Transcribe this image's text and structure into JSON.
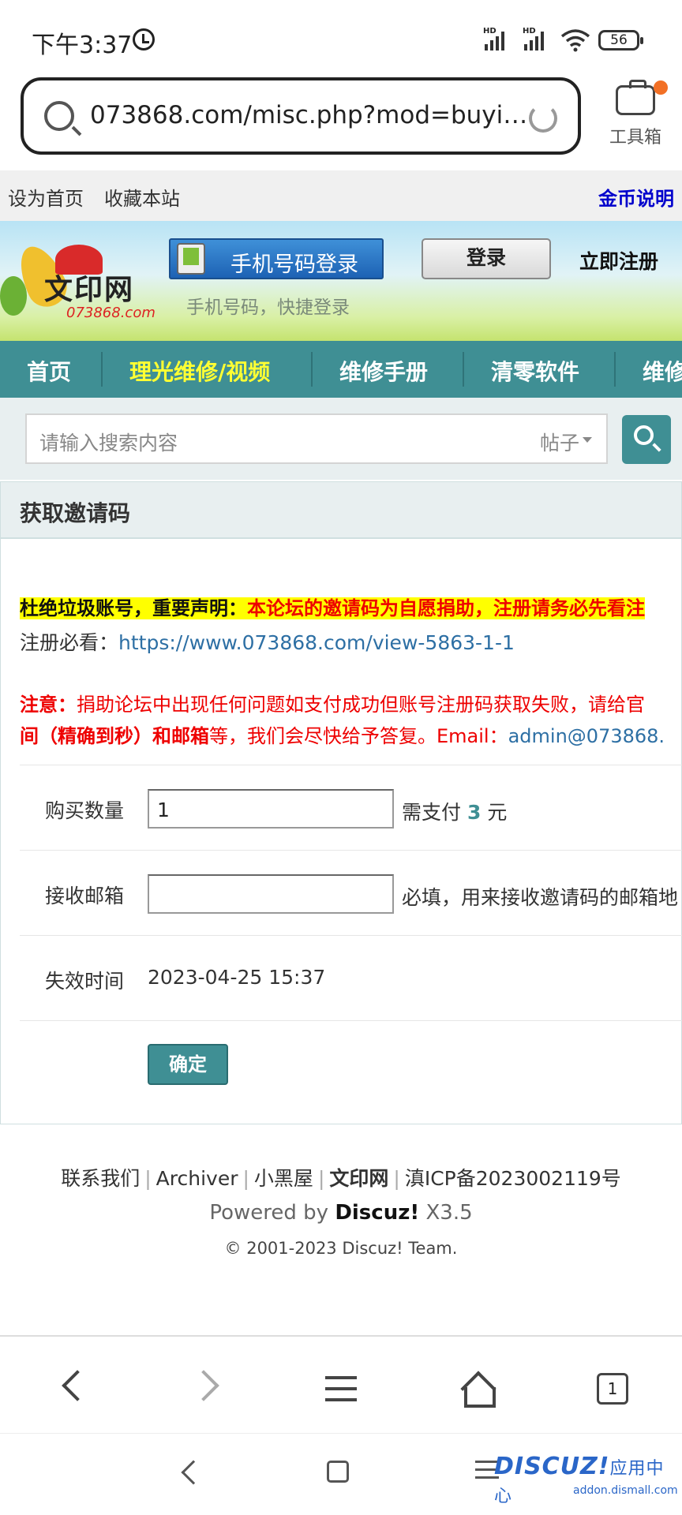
{
  "status_bar": {
    "time": "下午3:37",
    "battery": "56",
    "signal_label": "HD"
  },
  "browser": {
    "url": "073868.com/misc.php?mod=buyi…",
    "toolbox_label": "工具箱"
  },
  "top_links": {
    "set_home": "设为首页",
    "bookmark": "收藏本站",
    "coins": "金币说明"
  },
  "header": {
    "logo_text": "文印网",
    "logo_url": "073868.com",
    "phone_login": "手机号码登录",
    "phone_sub": "手机号码，快捷登录",
    "login": "登录",
    "register": "立即注册"
  },
  "nav": {
    "items": [
      {
        "label": "首页"
      },
      {
        "label": "理光维修/视频"
      },
      {
        "label": "维修手册"
      },
      {
        "label": "清零软件"
      },
      {
        "label": "维修"
      }
    ]
  },
  "search": {
    "placeholder": "请输入搜索内容",
    "type": "帖子"
  },
  "panel": {
    "title": "获取邀请码",
    "notice_bold": "杜绝垃圾账号，重要声明：",
    "notice_rest": "本论坛的邀请码为自愿捐助，注册请务必先看注",
    "must_label": "注册必看：",
    "must_link": "https://www.073868.com/view-5863-1-1",
    "warn_label": "注意：",
    "warn_line1": "捐助论坛中出现任何问题如支付成功但账号注册码获取失败，请给官",
    "warn_line2_bold": "间（精确到秒）和邮箱",
    "warn_line2_rest": "等，我们会尽快给予答复。Email：",
    "warn_email": "admin@073868.",
    "form": {
      "qty_label": "购买数量",
      "qty_value": "1",
      "pay_prefix": "需支付",
      "pay_amount": "3",
      "pay_unit": "元",
      "email_label": "接收邮箱",
      "email_value": "",
      "email_hint": "必填，用来接收邀请码的邮箱地",
      "expire_label": "失效时间",
      "expire_value": "2023-04-25 15:37",
      "submit": "确定"
    }
  },
  "footer": {
    "contact": "联系我们",
    "archiver": "Archiver",
    "blackroom": "小黑屋",
    "site": "文印网",
    "icp": "滇ICP备2023002119号",
    "powered_prefix": "Powered by",
    "powered_brand": "Discuz!",
    "powered_version": "X3.5",
    "copyright": "© 2001-2023 Discuz! Team."
  },
  "bottom_toolbar": {
    "tab_count": "1"
  },
  "watermark": {
    "brand": "DISCUZ!",
    "cn": "应用中心",
    "sub": "addon.dismall.com"
  },
  "colors": {
    "accent": "#3f8f94",
    "nav_highlight": "#ffff33",
    "warning": "#e00000",
    "link": "#2d6fa4"
  }
}
